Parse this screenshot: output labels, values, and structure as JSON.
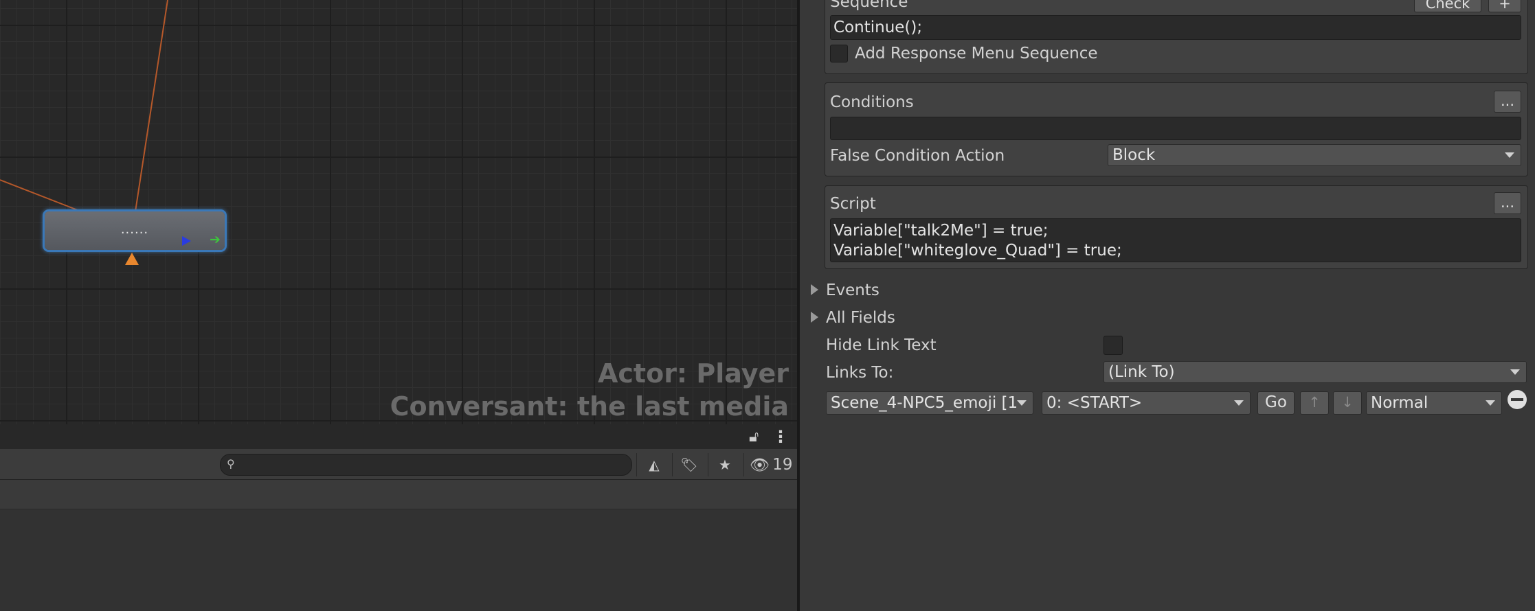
{
  "graph": {
    "node_label": "......",
    "actor_text": "Actor: Player",
    "conversant_text": "Conversant: the last media"
  },
  "project_panel": {
    "search_placeholder": "",
    "hidden_count": "19"
  },
  "inspector": {
    "sequence": {
      "label": "Sequence",
      "check_button": "Check",
      "add_button": "+",
      "value": "Continue();",
      "add_response_menu_label": "Add Response Menu Sequence"
    },
    "conditions": {
      "label": "Conditions",
      "menu_button": "...",
      "value": "",
      "false_action_label": "False Condition Action",
      "false_action_value": "Block"
    },
    "script": {
      "label": "Script",
      "menu_button": "...",
      "lines": [
        "Variable[\"talk2Me\"] = true;",
        "Variable[\"whiteglove_Quad\"] = true;"
      ]
    },
    "events_label": "Events",
    "all_fields_label": "All Fields",
    "hide_link_text_label": "Hide Link Text",
    "links_to_label": "Links To:",
    "links_to_value": "(Link To)",
    "link": {
      "conversation": "Scene_4-NPC5_emoji [1",
      "entry": "0: <START>",
      "go_button": "Go",
      "up_button": "↑",
      "down_button": "↓",
      "priority": "Normal"
    }
  },
  "colors": {
    "graph_bg": "#282828",
    "node_highlight": "#3a78b8",
    "link_line": "#b5582a",
    "start_arrow": "#e8872e",
    "play_arrow": "#2a3ce0",
    "link_arrow": "#3ec53e"
  }
}
